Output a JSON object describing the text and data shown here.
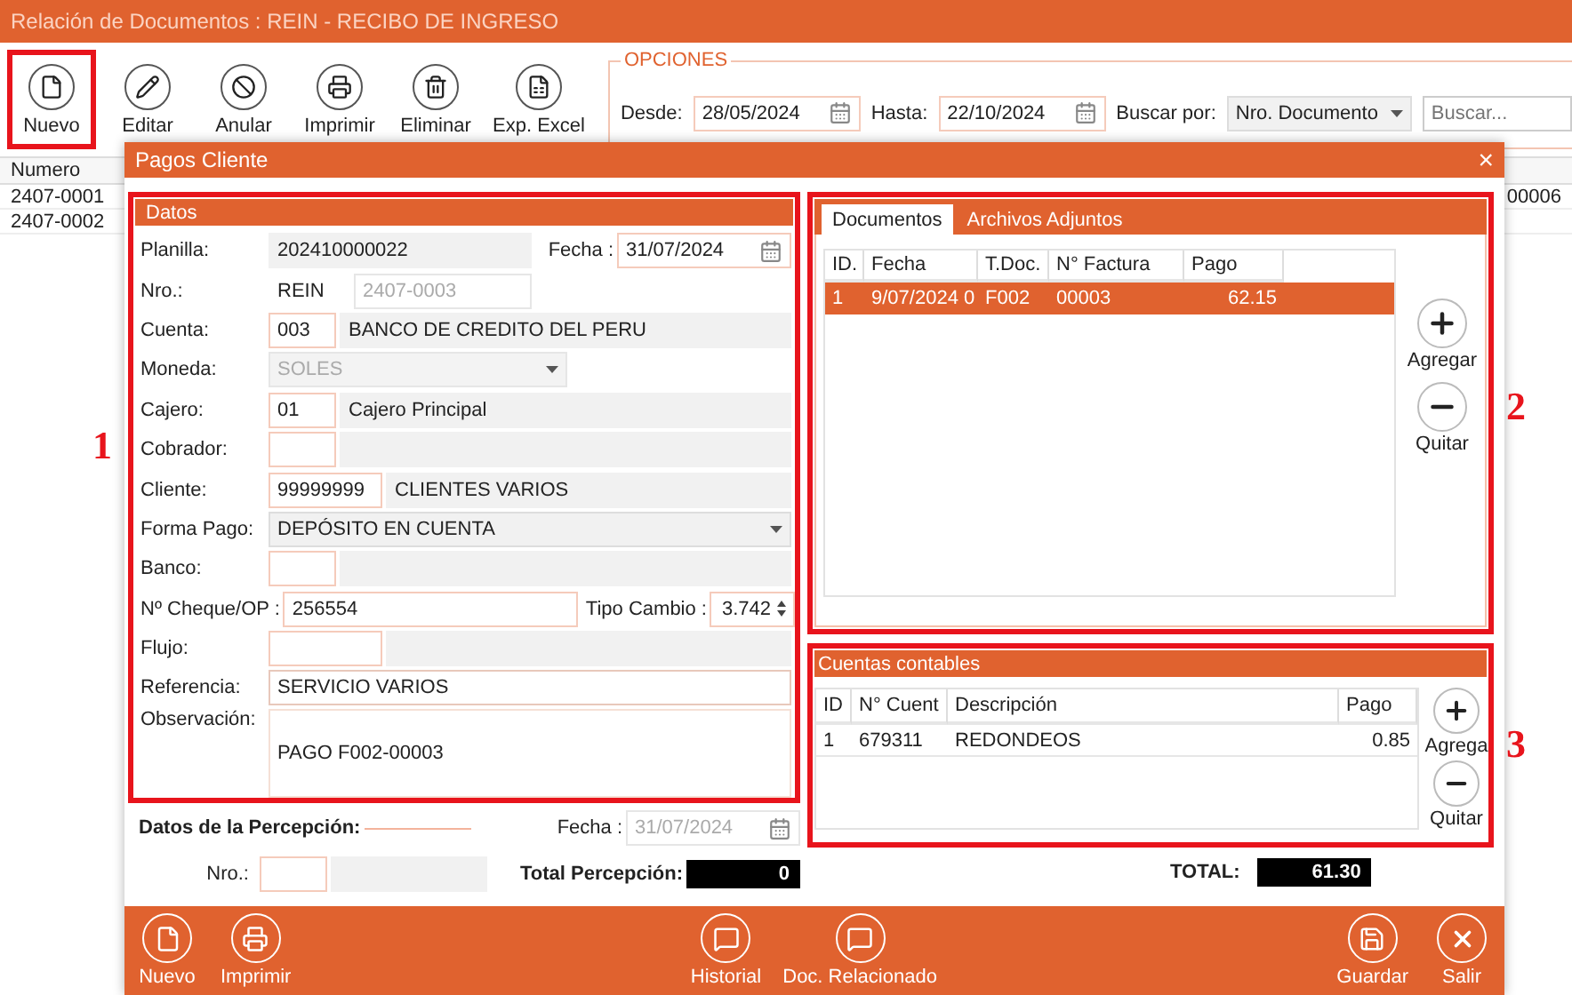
{
  "window": {
    "title": "Relación de Documentos : REIN - RECIBO DE INGRESO"
  },
  "toolbar": [
    {
      "label": "Nuevo",
      "kind": "file",
      "highlighted": true
    },
    {
      "label": "Editar",
      "kind": "pencil",
      "highlighted": false
    },
    {
      "label": "Anular",
      "kind": "ban",
      "highlighted": false
    },
    {
      "label": "Imprimir",
      "kind": "print",
      "highlighted": false
    },
    {
      "label": "Eliminar",
      "kind": "trash",
      "highlighted": false
    },
    {
      "label": "Exp. Excel",
      "kind": "excel",
      "highlighted": false
    }
  ],
  "options": {
    "title": "OPCIONES",
    "desde_label": "Desde:",
    "desde": "28/05/2024",
    "hasta_label": "Hasta:",
    "hasta": "22/10/2024",
    "buscar_por_label": "Buscar por:",
    "buscar_por": "Nro. Documento",
    "search_placeholder": "Buscar..."
  },
  "list": {
    "columns": [
      "Numero"
    ],
    "rows": [
      {
        "numero": "2407-0001",
        "column_2": "00006"
      },
      {
        "numero": "2407-0002"
      }
    ]
  },
  "dialog": {
    "title": "Pagos Cliente",
    "close": "×",
    "datos": {
      "title": "Datos",
      "planilla": {
        "label": "Planilla:",
        "value": "202410000022"
      },
      "fecha": {
        "label": "Fecha :",
        "value": "31/07/2024"
      },
      "nro": {
        "label": "Nro.:",
        "serie": "REIN",
        "placeholder": "2407-0003"
      },
      "cuenta": {
        "label": "Cuenta:",
        "code": "003",
        "name": "BANCO DE CREDITO DEL PERU"
      },
      "moneda": {
        "label": "Moneda:",
        "value": "SOLES",
        "disabled": true
      },
      "cajero": {
        "label": "Cajero:",
        "code": "01",
        "name": "Cajero Principal"
      },
      "cobrador": {
        "label": "Cobrador:"
      },
      "cliente": {
        "label": "Cliente:",
        "code": "99999999",
        "name": "CLIENTES VARIOS"
      },
      "forma_pago": {
        "label": "Forma Pago:",
        "value": "DEPÓSITO EN CUENTA",
        "disabled": false
      },
      "banco": {
        "label": "Banco:"
      },
      "cheque": {
        "label": "Nº Cheque/OP :",
        "value": "256554"
      },
      "tipo_cambio": {
        "label": "Tipo Cambio :",
        "value": "3.742"
      },
      "flujo": {
        "label": "Flujo:"
      },
      "referencia": {
        "label": "Referencia:",
        "value": "SERVICIO VARIOS"
      },
      "observacion": {
        "label": "Observación:",
        "value": "PAGO F002-00003"
      }
    },
    "percepcion": {
      "title": "Datos de la Percepción:",
      "fecha_label": "Fecha :",
      "fecha": "31/07/2024",
      "fecha_disabled": true,
      "nro_label": "Nro.:",
      "total_label": "Total Percepción:",
      "total": "0"
    },
    "documentos": {
      "tabs": [
        {
          "label": "Documentos",
          "selected": true
        },
        {
          "label": "Archivos Adjuntos",
          "selected": false
        }
      ],
      "columns": [
        "ID.",
        "Fecha",
        "T.Doc.",
        "N° Factura",
        "Pago"
      ],
      "rows": [
        {
          "cells": [
            "1",
            "9/07/2024 0",
            "F002",
            "00003",
            "62.15"
          ],
          "selected": true
        }
      ],
      "buttons": [
        {
          "label": "Agregar",
          "kind": "plus"
        },
        {
          "label": "Quitar",
          "kind": "minus"
        }
      ]
    },
    "cuentas": {
      "title": "Cuentas contables",
      "columns": [
        "ID",
        "N° Cuent",
        "Descripción",
        "Pago"
      ],
      "rows": [
        {
          "cells": [
            "1",
            "679311",
            "REDONDEOS",
            "0.85"
          ],
          "selected": false
        }
      ],
      "buttons": [
        {
          "label": "Agrega",
          "kind": "plus"
        },
        {
          "label": "Quitar",
          "kind": "minus"
        }
      ]
    },
    "total": {
      "label": "TOTAL:",
      "value": "61.30"
    },
    "footer": {
      "left": [
        {
          "label": "Nuevo",
          "kind": "file"
        },
        {
          "label": "Imprimir",
          "kind": "print"
        }
      ],
      "center": [
        {
          "label": "Historial",
          "kind": "chat"
        },
        {
          "label": "Doc. Relacionado",
          "kind": "chat"
        }
      ],
      "right": [
        {
          "label": "Guardar",
          "kind": "save"
        },
        {
          "label": "Salir",
          "kind": "close"
        }
      ]
    }
  },
  "annotations": [
    "1",
    "2",
    "3"
  ]
}
